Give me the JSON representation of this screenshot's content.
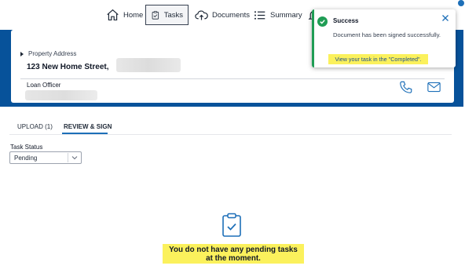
{
  "nav": {
    "items": [
      {
        "label": "Home",
        "icon": "house-icon"
      },
      {
        "label": "Tasks",
        "icon": "clipboard-check-icon"
      },
      {
        "label": "Documents",
        "icon": "cloud-upload-icon"
      },
      {
        "label": "Summary",
        "icon": "list-icon"
      }
    ],
    "active": "Tasks"
  },
  "loan_card": {
    "property_address_label": "Property Address",
    "property_address_value": "123 New Home Street,",
    "loan_officer_label": "Loan Officer"
  },
  "tabs": [
    {
      "label": "UPLOAD (1)"
    },
    {
      "label": "REVIEW & SIGN",
      "active": true
    }
  ],
  "task_status": {
    "label": "Task Status",
    "selected": "Pending"
  },
  "empty_state": {
    "line1": "You do not have any pending tasks",
    "line2": "at the moment."
  },
  "toast": {
    "title": "Success",
    "message": "Document has been signed successfully.",
    "link": "View your task in the \"Completed\"."
  },
  "colors": {
    "brand": "#07529a",
    "accent": "#1d6fb8",
    "success": "#1f9d55",
    "highlight": "#fbf15c"
  }
}
